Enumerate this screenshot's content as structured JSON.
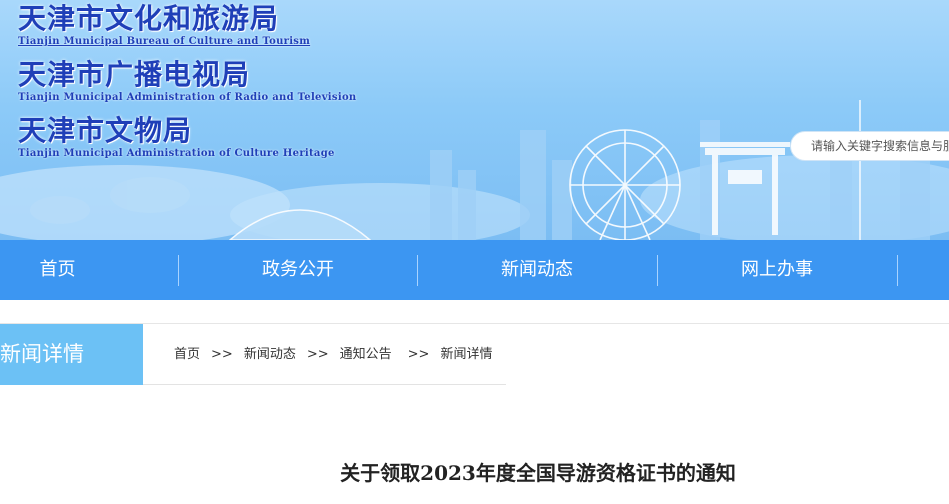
{
  "header": {
    "titles": [
      {
        "cn": "天津市文化和旅游局",
        "en": "Tianjin Municipal Bureau of Culture and Tourism"
      },
      {
        "cn": "天津市广播电视局",
        "en": "Tianjin Municipal Administration of Radio and Television"
      },
      {
        "cn": "天津市文物局",
        "en": "Tianjin Municipal Administration of Culture Heritage"
      }
    ],
    "search": {
      "placeholder": "请输入关键字搜索信息与服务"
    }
  },
  "nav": {
    "items": [
      {
        "label": "首页"
      },
      {
        "label": "政务公开"
      },
      {
        "label": "新闻动态"
      },
      {
        "label": "网上办事"
      }
    ]
  },
  "section": {
    "label": "新闻详情",
    "breadcrumb": [
      "首页",
      "新闻动态",
      "通知公告",
      "新闻详情"
    ],
    "separator": ">>"
  },
  "article": {
    "title": "关于领取2023年度全国导游资格证书的通知"
  },
  "colors": {
    "nav_bg": "#3c96f2",
    "section_label_bg": "#6cc1f5",
    "banner_title": "#1f3fb8"
  }
}
